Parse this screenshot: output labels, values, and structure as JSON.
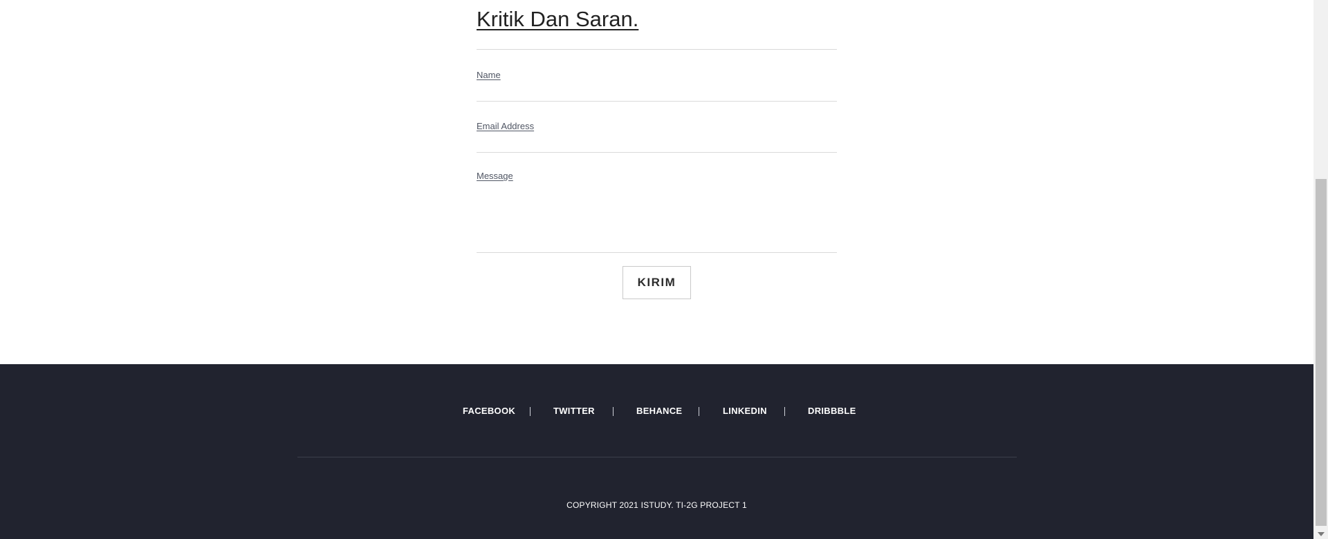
{
  "form": {
    "title": "Kritik Dan Saran.",
    "name_label": "Name",
    "email_label": "Email Address",
    "message_label": "Message",
    "name_value": "",
    "email_value": "",
    "message_value": "",
    "submit_label": "KIRIM"
  },
  "footer": {
    "social_links": [
      "FACEBOOK",
      "TWITTER",
      "BEHANCE",
      "LINKEDIN",
      "DRIBBBLE"
    ],
    "copyright": "COPYRIGHT 2021 ISTUDY. TI-2G PROJECT 1"
  },
  "colors": {
    "footer_bg": "#21232f",
    "text_dark": "#212121",
    "label_color": "#4f5563"
  }
}
